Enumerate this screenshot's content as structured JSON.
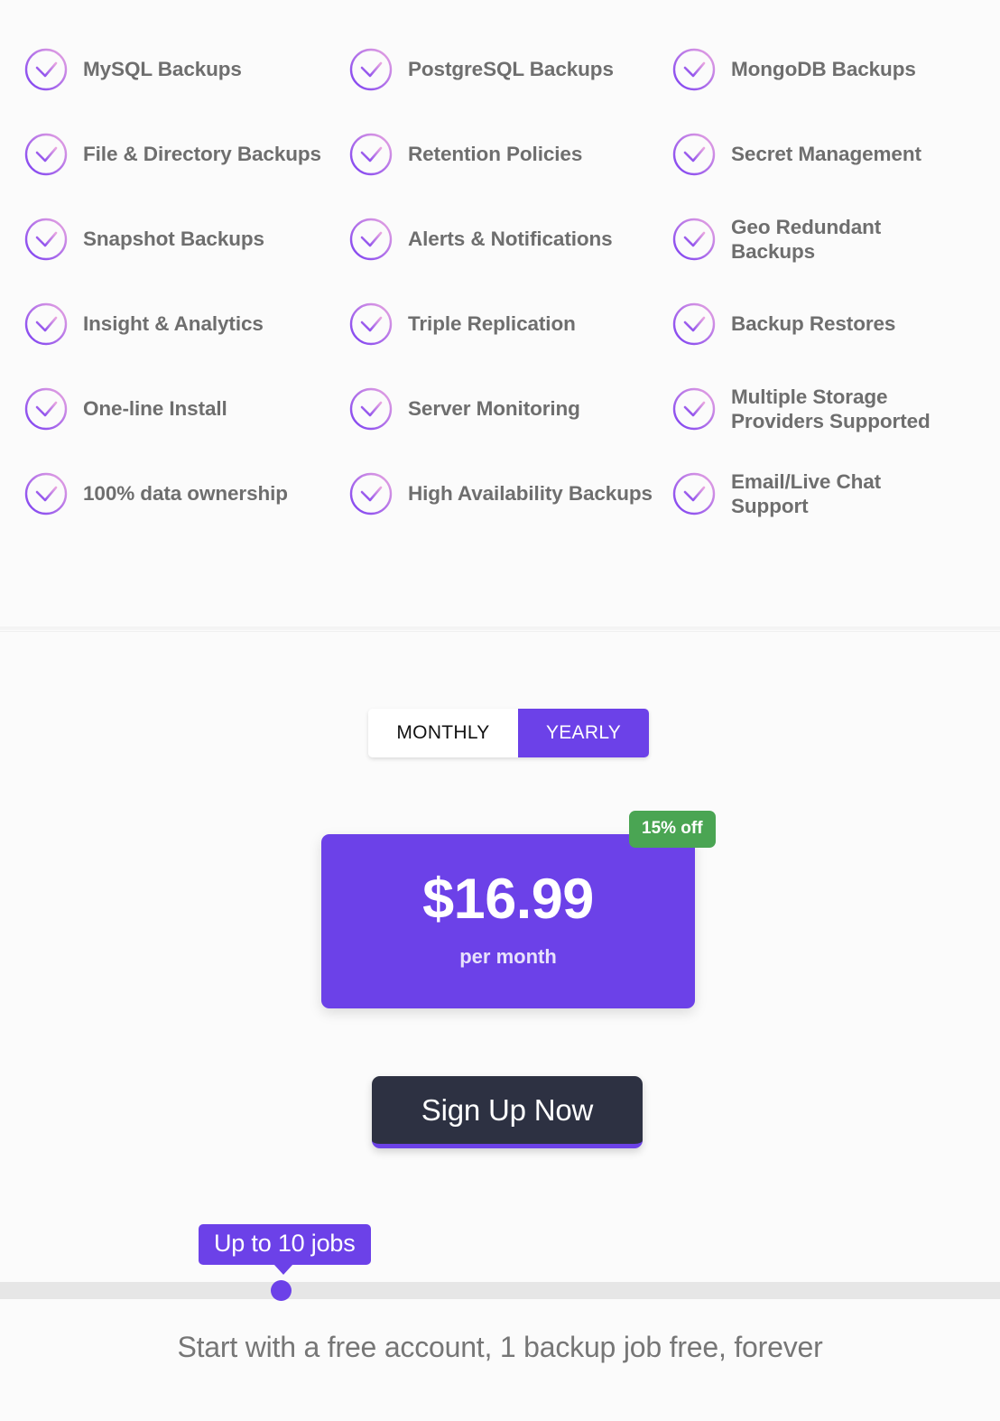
{
  "features": {
    "icon": "check-circle-icon",
    "accent_color": "#9b5cf6",
    "text_color": "#6e6e6e",
    "items": [
      "MySQL Backups",
      "PostgreSQL Backups",
      "MongoDB Backups",
      "File & Directory Backups",
      "Retention Policies",
      "Secret Management",
      "Snapshot Backups",
      "Alerts & Notifications",
      "Geo Redundant Backups",
      "Insight & Analytics",
      "Triple Replication",
      "Backup Restores",
      "One-line Install",
      "Server Monitoring",
      "Multiple Storage Providers Supported",
      "100% data ownership",
      "High Availability Backups",
      "Email/Live Chat Support"
    ]
  },
  "pricing": {
    "billing_toggle": {
      "monthly_label": "MONTHLY",
      "yearly_label": "YEARLY",
      "selected": "YEARLY",
      "selected_bg": "#6c41e8",
      "unselected_bg": "#ffffff"
    },
    "price_card": {
      "amount": "$16.99",
      "period": "per month",
      "background": "#6c41e8"
    },
    "discount_badge": {
      "label": "15% off",
      "background": "#4aa553"
    },
    "signup_button": {
      "label": "Sign Up Now",
      "background": "#2d3142",
      "underline_color": "#6c41e8"
    },
    "jobs_slider": {
      "tooltip_label": "Up to 10 jobs",
      "tooltip_background": "#6c41e8",
      "track_color": "#e6e6e6",
      "thumb_color": "#6c41e8",
      "value": 10,
      "thumb_position_percent": 28
    },
    "footnote": "Start with a free account, 1 backup job free, forever"
  }
}
